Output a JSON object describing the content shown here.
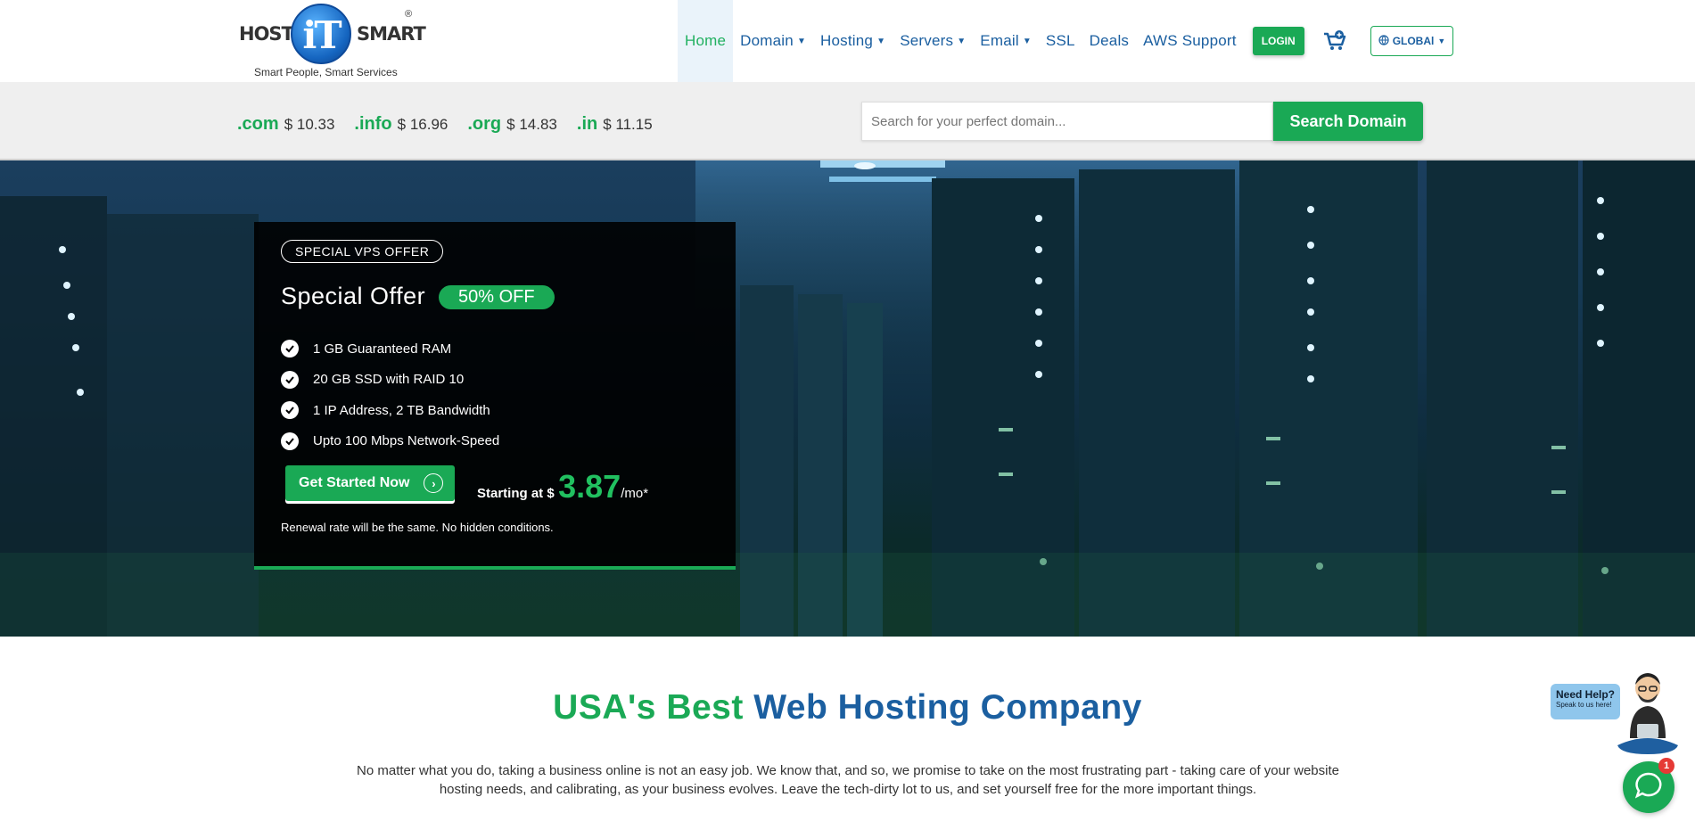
{
  "brand": {
    "word_left": "HOST",
    "word_mid": "iT",
    "word_right": "SMART",
    "registered": "®",
    "tagline": "Smart People, Smart Services"
  },
  "nav": {
    "items": [
      {
        "label": "Home",
        "dropdown": false,
        "active": true
      },
      {
        "label": "Domain",
        "dropdown": true
      },
      {
        "label": "Hosting",
        "dropdown": true
      },
      {
        "label": "Servers",
        "dropdown": true
      },
      {
        "label": "Email",
        "dropdown": true
      },
      {
        "label": "SSL",
        "dropdown": false
      },
      {
        "label": "Deals",
        "dropdown": false
      },
      {
        "label": "AWS Support",
        "dropdown": false
      }
    ],
    "login_label": "LOGIN",
    "region_label": "GLOBAl"
  },
  "domains": {
    "tlds": [
      {
        "ext": ".com",
        "price": "$ 10.33"
      },
      {
        "ext": ".info",
        "price": "$ 16.96"
      },
      {
        "ext": ".org",
        "price": "$ 14.83"
      },
      {
        "ext": ".in",
        "price": "$ 11.15"
      }
    ],
    "search_placeholder": "Search for your perfect domain...",
    "search_button": "Search Domain"
  },
  "offer": {
    "badge": "SPECIAL VPS OFFER",
    "title": "Special Offer",
    "discount": "50% OFF",
    "features": [
      "1 GB Guaranteed RAM",
      "20 GB SSD with RAID 10",
      "1 IP Address, 2 TB Bandwidth",
      "Upto 100 Mbps Network-Speed"
    ],
    "cta_label": "Get Started Now",
    "price_prefix": "Starting at $",
    "price": "3.87",
    "price_suffix": "/mo*",
    "note": "Renewal rate will be the same. No hidden conditions."
  },
  "section": {
    "headline_green": "USA's Best",
    "headline_blue": "Web Hosting Company",
    "intro": "No matter what you do, taking a business online is not an easy job. We know that, and so, we promise to take on the most frustrating part - taking care of your website hosting needs, and calibrating, as your business evolves. Leave the tech-dirty lot to us, and set yourself free for the more important things."
  },
  "help": {
    "title": "Need Help?",
    "subtitle": "Speak to us here!",
    "unread_count": "1"
  },
  "colors": {
    "accent_green": "#1aa955",
    "brand_blue": "#1b5fa0",
    "hero_dark": "#0f2d40"
  }
}
